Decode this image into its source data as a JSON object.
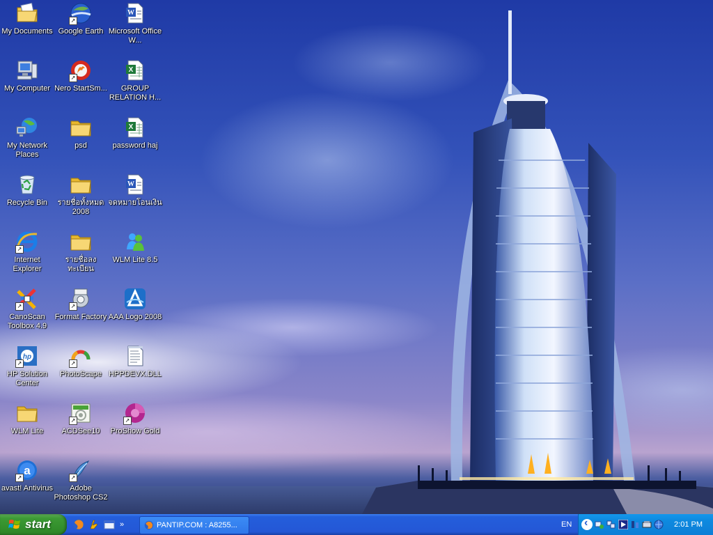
{
  "desktop": {
    "icons": [
      {
        "label": "My Documents",
        "icon": "folder-documents-icon"
      },
      {
        "label": "Google Earth",
        "icon": "google-earth-icon"
      },
      {
        "label": "Microsoft Office W...",
        "icon": "word-document-icon"
      },
      {
        "label": "My Computer",
        "icon": "computer-icon"
      },
      {
        "label": "Nero StartSm...",
        "icon": "nero-icon"
      },
      {
        "label": "GROUP RELATION H...",
        "icon": "excel-document-icon"
      },
      {
        "label": "My Network Places",
        "icon": "network-places-icon"
      },
      {
        "label": "psd",
        "icon": "folder-icon"
      },
      {
        "label": "password haj",
        "icon": "excel-document-icon"
      },
      {
        "label": "Recycle Bin",
        "icon": "recycle-bin-icon"
      },
      {
        "label": "รายชื่อทั้งหมด 2008",
        "icon": "folder-icon"
      },
      {
        "label": "จดหมายโอนเงิน",
        "icon": "word-document-icon"
      },
      {
        "label": "Internet Explorer",
        "icon": "internet-explorer-icon"
      },
      {
        "label": "รายชื่อลงทะเบียน",
        "icon": "folder-icon"
      },
      {
        "label": "WLM Lite 8.5",
        "icon": "messenger-icon"
      },
      {
        "label": "CanoScan Toolbox 4.9",
        "icon": "canoscan-icon"
      },
      {
        "label": "Format Factory",
        "icon": "format-factory-icon"
      },
      {
        "label": "AAA Logo 2008",
        "icon": "aaa-logo-icon"
      },
      {
        "label": "HP Solution Center",
        "icon": "hp-icon"
      },
      {
        "label": "PhotoScape",
        "icon": "photoscape-icon"
      },
      {
        "label": "HPPDEVX.DLL",
        "icon": "text-file-icon"
      },
      {
        "label": "WLM Lite",
        "icon": "folder-icon"
      },
      {
        "label": "ACDSee10",
        "icon": "acdsee-icon"
      },
      {
        "label": "ProShow Gold",
        "icon": "proshow-icon"
      },
      {
        "label": "avast! Antivirus",
        "icon": "avast-icon"
      },
      {
        "label": "Adobe Photoshop CS2",
        "icon": "photoshop-icon"
      }
    ]
  },
  "taskbar": {
    "start_label": "start",
    "quick_launch": [
      "firefox-icon",
      "winamp-icon",
      "show-desktop-icon"
    ],
    "quick_launch_more": "»",
    "tasks": [
      {
        "label": "PANTIP.COM : A8255...",
        "icon": "firefox-icon"
      }
    ],
    "language": "EN",
    "tray_icons": [
      "network-icon",
      "network-connection-icon",
      "media-player-icon",
      "sync-icon",
      "device-icon",
      "globe-icon"
    ],
    "clock": "2:01 PM"
  },
  "colors": {
    "taskbar_blue": "#245edb",
    "start_green": "#3c9a34",
    "tray_blue": "#0e8ae0"
  }
}
